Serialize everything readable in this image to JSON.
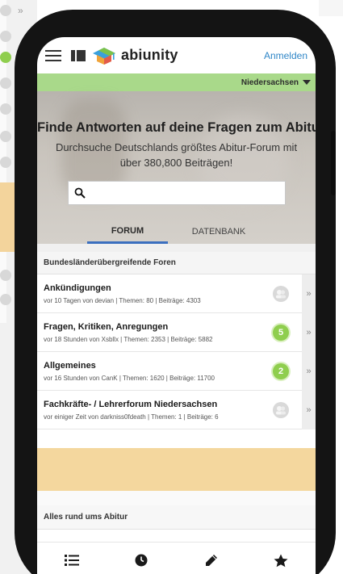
{
  "header": {
    "logo_text": "abiunity",
    "login_label": "Anmelden"
  },
  "state_selector": {
    "value": "Niedersachsen"
  },
  "hero": {
    "title": "Finde Antworten auf deine Fragen zum Abitur:",
    "subtitle": "Durchsuche Deutschlands größtes Abitur-Forum mit über 380,800 Beiträgen!"
  },
  "search": {
    "placeholder": ""
  },
  "tabs": [
    {
      "label": "FORUM",
      "active": true
    },
    {
      "label": "DATENBANK",
      "active": false
    }
  ],
  "sections": [
    {
      "title": "Bundesländerübergreifende Foren",
      "forums": [
        {
          "title": "Ankündigungen",
          "meta": "vor 10 Tagen von devian | Themen: 80 | Beiträge: 4303",
          "badge": "",
          "badge_style": "grey"
        },
        {
          "title": "Fragen, Kritiken, Anregungen",
          "meta": "vor 18 Stunden von Xsbllx | Themen: 2353 | Beiträge: 5882",
          "badge": "5",
          "badge_style": "green"
        },
        {
          "title": "Allgemeines",
          "meta": "vor 16 Stunden von CanK | Themen: 1620 | Beiträge: 11700",
          "badge": "2",
          "badge_style": "green"
        },
        {
          "title": "Fachkräfte- / Lehrerforum Niedersachsen",
          "meta": "vor einiger Zeit von darkniss0fdeath | Themen: 1 | Beiträge: 6",
          "badge": "",
          "badge_style": "grey"
        }
      ]
    },
    {
      "title": "Alles rund ums Abitur",
      "forums": []
    }
  ],
  "bottom_nav": [
    {
      "icon": "list-icon"
    },
    {
      "icon": "clock-icon"
    },
    {
      "icon": "pencil-icon"
    },
    {
      "icon": "star-icon"
    }
  ],
  "colors": {
    "state_bar": "#a9d98a",
    "accent_blue": "#3b6fbf",
    "link_blue": "#2f86c7",
    "badge_green": "#8fce4e",
    "banner": "#f4d79e"
  }
}
